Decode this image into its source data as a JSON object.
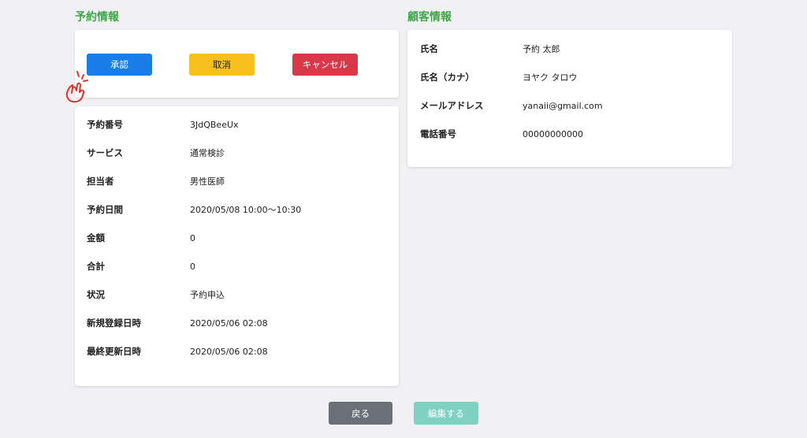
{
  "reservation": {
    "section_title": "予約情報",
    "actions": {
      "approve_label": "承認",
      "revoke_label": "取消",
      "cancel_label": "キャンセル"
    },
    "fields": [
      {
        "label": "予約番号",
        "value": "3JdQBeeUx"
      },
      {
        "label": "サービス",
        "value": "通常検診"
      },
      {
        "label": "担当者",
        "value": "男性医師"
      },
      {
        "label": "予約日間",
        "value": "2020/05/08 10:00〜10:30"
      },
      {
        "label": "金額",
        "value": "0"
      },
      {
        "label": "合計",
        "value": "0"
      },
      {
        "label": "状況",
        "value": "予約申込"
      },
      {
        "label": "新規登録日時",
        "value": "2020/05/06 02:08"
      },
      {
        "label": "最終更新日時",
        "value": "2020/05/06 02:08"
      }
    ]
  },
  "customer": {
    "section_title": "顧客情報",
    "fields": [
      {
        "label": "氏名",
        "value": "予約 太郎"
      },
      {
        "label": "氏名（カナ）",
        "value": "ヨヤク タロウ"
      },
      {
        "label": "メールアドレス",
        "value": "yanaii@gmail.com"
      },
      {
        "label": "電話番号",
        "value": "00000000000"
      }
    ]
  },
  "footer": {
    "back_label": "戻る",
    "edit_label": "編集する"
  },
  "colors": {
    "section_title": "#3fa64a",
    "approve": "#1a7ee8",
    "revoke": "#f7c01c",
    "cancel": "#d93849",
    "back": "#6b7078",
    "edit": "#7fd1c1",
    "pointer": "#e0322b"
  },
  "icons": {
    "pointer": "pointing-hand-icon"
  }
}
